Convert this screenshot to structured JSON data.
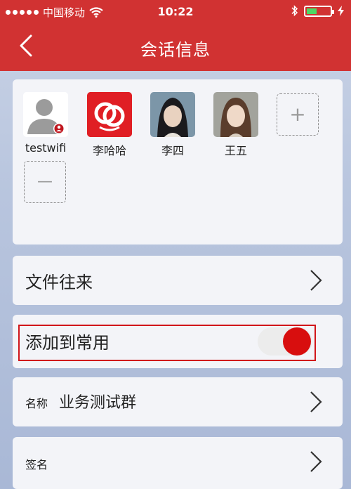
{
  "status_bar": {
    "carrier": "中国移动",
    "time": "10:22"
  },
  "nav": {
    "title": "会话信息"
  },
  "members": [
    {
      "name": "testwifi",
      "avatar": "default-user-avatar"
    },
    {
      "name": "李哈哈",
      "avatar": "app-logo-avatar"
    },
    {
      "name": "李四",
      "avatar": "character-portrait-avatar"
    },
    {
      "name": "王五",
      "avatar": "character-portrait-avatar"
    }
  ],
  "add_member_symbol": "+",
  "remove_member_symbol": "—",
  "rows": {
    "files": {
      "label": "文件往来"
    },
    "favorite": {
      "label": "添加到常用",
      "enabled": true
    },
    "name": {
      "label": "名称",
      "value": "业务测试群"
    },
    "signature": {
      "label": "签名"
    }
  },
  "colors": {
    "header_red": "#d13232",
    "toggle_on": "#d80e0e",
    "highlight_border": "#d1151a"
  }
}
